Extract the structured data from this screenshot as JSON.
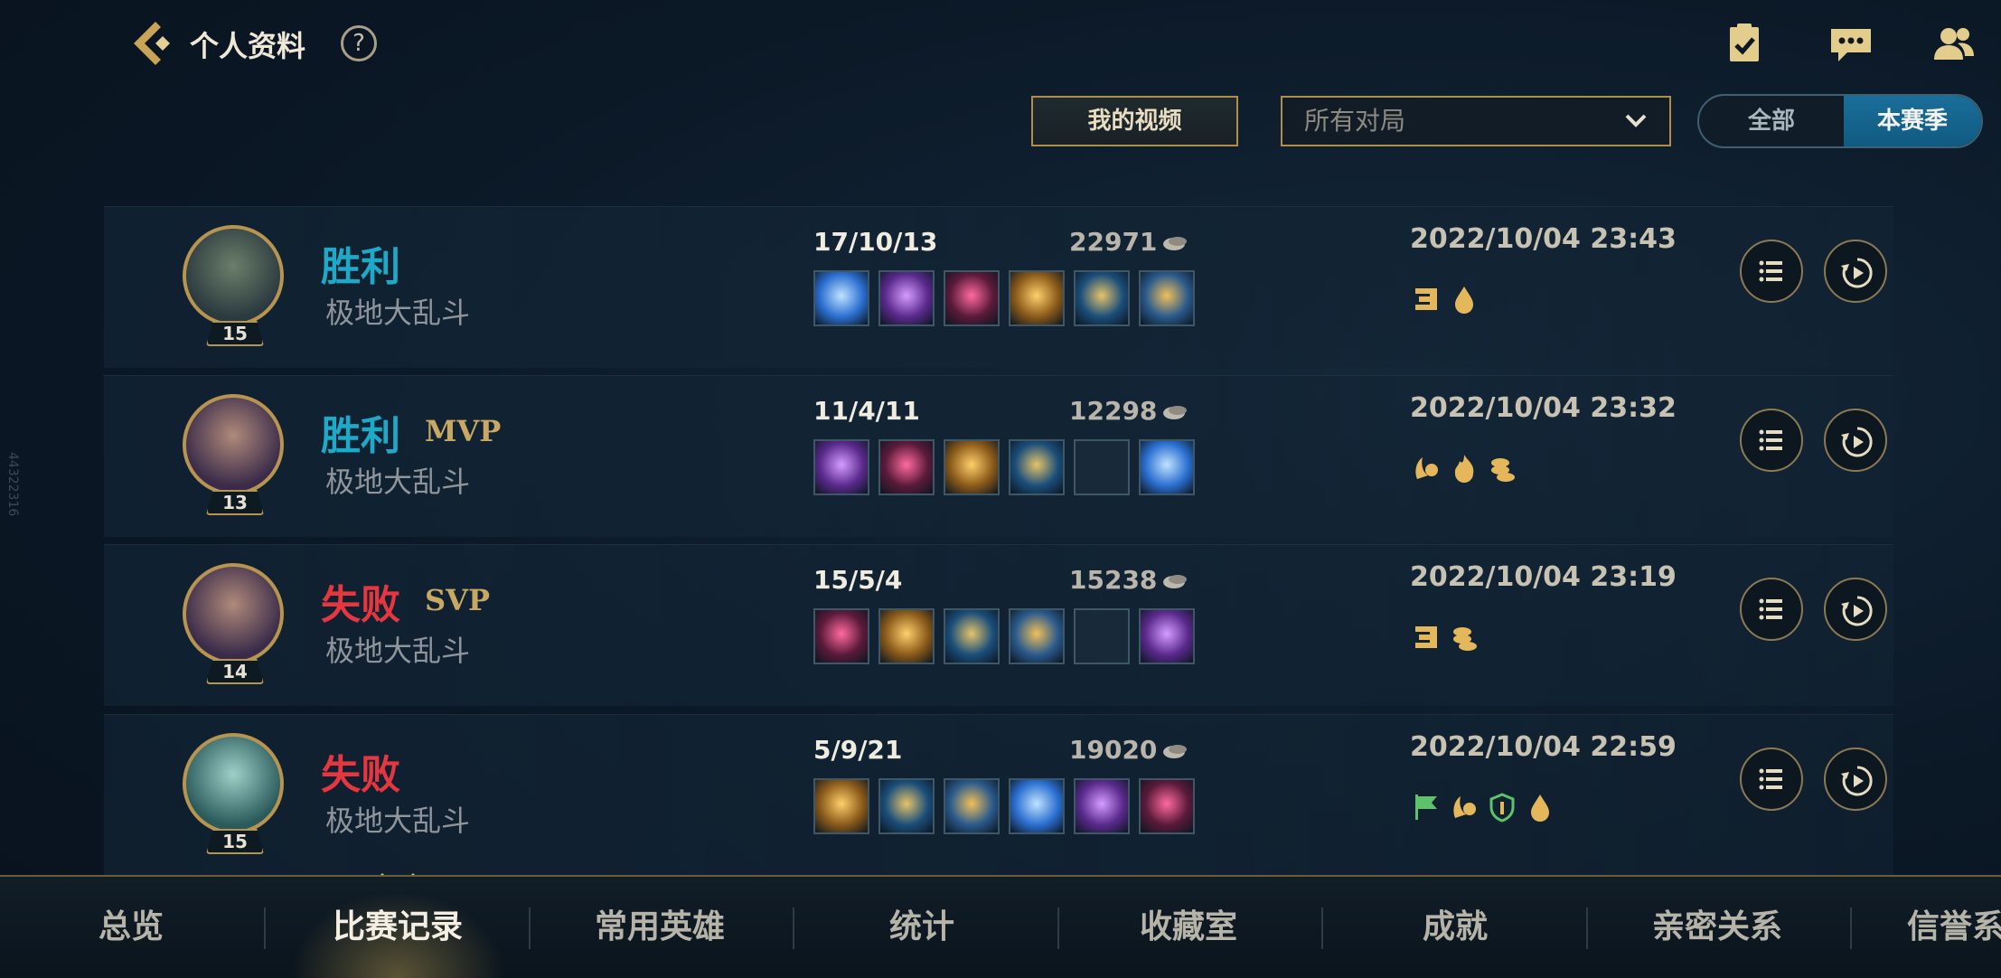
{
  "header": {
    "title": "个人资料",
    "help": "?"
  },
  "filters": {
    "my_videos": "我的视频",
    "match_select_value": "所有对局",
    "toggle_all": "全部",
    "toggle_season": "本赛季"
  },
  "side_id": "44322316",
  "matches": [
    {
      "result": "胜利",
      "result_type": "win",
      "badge": "",
      "mode": "极地大乱斗",
      "level": "15",
      "kda": "17/10/13",
      "gold": "22971",
      "date": "2022/10/04 23:43",
      "items": [
        "item-spear-icon",
        "item-sword-purple-icon",
        "item-dagger-icon",
        "item-winged-armor-icon",
        "item-cannon-icon",
        "item-boots-icon"
      ],
      "honors": [
        "triple-kill-icon",
        "flame-drop-icon"
      ]
    },
    {
      "result": "胜利",
      "result_type": "win",
      "badge": "MVP",
      "mode": "极地大乱斗",
      "level": "13",
      "kda": "11/4/11",
      "gold": "12298",
      "date": "2022/10/04 23:32",
      "items": [
        "item-spear-icon",
        "item-purple-blade-icon",
        "item-emerald-blade-icon",
        "item-cloak-icon",
        "empty",
        "item-boots-icon"
      ],
      "honors": [
        "laurel-icon",
        "fire-icon",
        "coins-icon"
      ]
    },
    {
      "result": "失败",
      "result_type": "lose",
      "badge": "SVP",
      "mode": "极地大乱斗",
      "level": "14",
      "kda": "15/5/4",
      "gold": "15238",
      "date": "2022/10/04 23:19",
      "items": [
        "item-spear-icon",
        "item-golden-blade-icon",
        "item-sun-orb-icon",
        "item-purple-blade-icon",
        "empty",
        "item-boots-icon"
      ],
      "honors": [
        "triple-kill-icon",
        "coins-icon"
      ]
    },
    {
      "result": "失败",
      "result_type": "lose",
      "badge": "",
      "mode": "极地大乱斗",
      "level": "15",
      "kda": "5/9/21",
      "gold": "19020",
      "date": "2022/10/04 22:59",
      "items": [
        "item-dark-gem-icon",
        "item-green-mask-icon",
        "item-tome-icon",
        "item-armor-icon",
        "item-blue-armor-icon",
        "item-sun-shield-icon"
      ],
      "honors": [
        "flag-icon",
        "laurel-icon",
        "shield-icon",
        "flame-drop-icon"
      ]
    }
  ],
  "nav": {
    "tabs": [
      "总览",
      "比赛记录",
      "常用英雄",
      "统计",
      "收藏室",
      "成就",
      "亲密关系",
      "信誉系"
    ]
  },
  "colors": {
    "win": "#1da9c7",
    "lose": "#e4373f",
    "gold_accent": "#b08e4a",
    "toggle_active": "#1a6e9a"
  },
  "icons": {
    "top_right": [
      "task-checklist-icon",
      "chat-icon",
      "friends-icon"
    ]
  }
}
